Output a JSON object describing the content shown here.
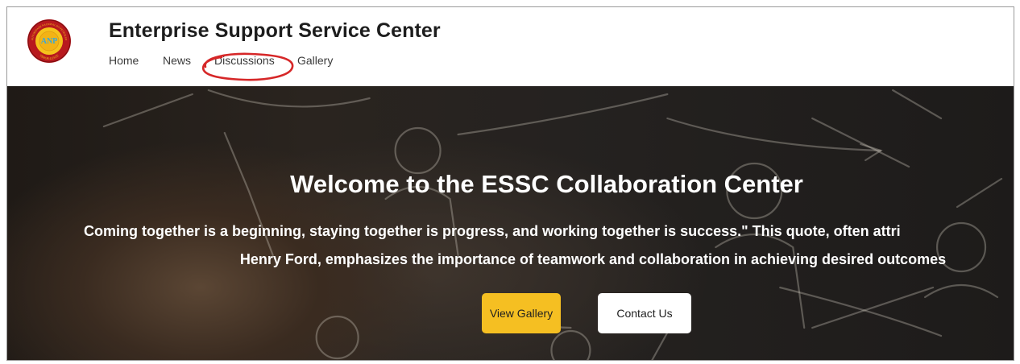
{
  "header": {
    "site_title": "Enterprise Support Service Center",
    "logo": {
      "text": "ANP",
      "ring_text_top": "AUTORIDADE NACIONAL DO PETRÓLEO",
      "ring_text_bottom": "TIMOR-LESTE",
      "colors": {
        "ring": "#b8191e",
        "center": "#f6c21c",
        "inner": "#3aa8d8"
      }
    },
    "nav": [
      {
        "label": "Home"
      },
      {
        "label": "News"
      },
      {
        "label": "Discussions",
        "annotated": true
      },
      {
        "label": "Gallery"
      }
    ],
    "annotation_color": "#d62728"
  },
  "hero": {
    "title": "Welcome to the ESSC Collaboration Center",
    "subtitle_line1": "Coming together is a beginning, staying together is progress, and working together is success.\" This quote, often attri",
    "subtitle_line2": "Henry Ford, emphasizes the importance of teamwork and collaboration in achieving desired outcomes",
    "buttons": {
      "view_gallery": "View Gallery",
      "contact_us": "Contact Us"
    },
    "colors": {
      "primary_button": "#f5bf22",
      "secondary_button": "#ffffff"
    }
  }
}
